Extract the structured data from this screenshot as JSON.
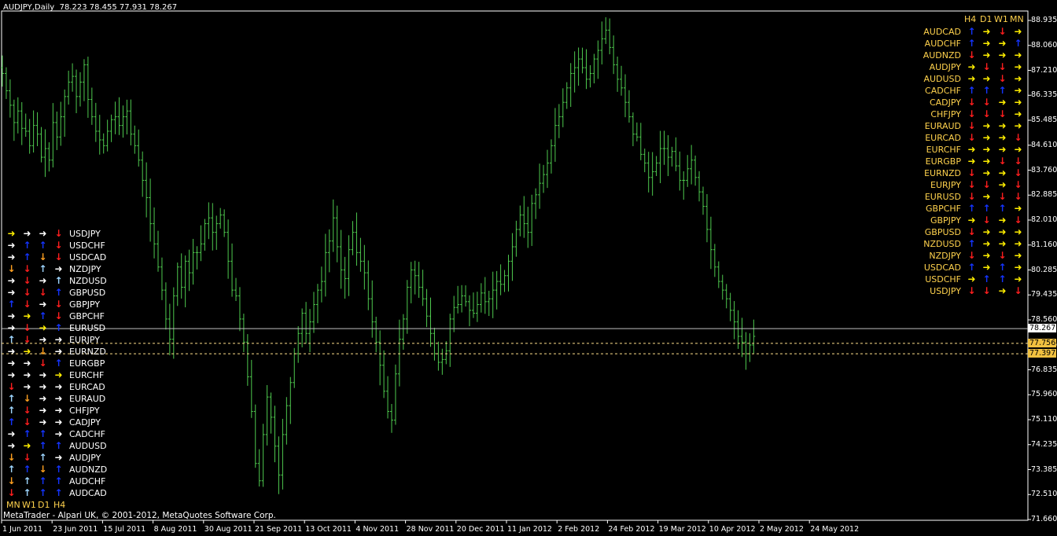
{
  "window": {
    "title": "AUDJPY,Daily",
    "ohlc": "78.223 78.455 77.931 78.267"
  },
  "copyright": "MetaTrader - Alpari UK, © 2001-2012, MetaQuotes Software Corp.",
  "colors": {
    "background": "#000000",
    "candle": "#4ec94e",
    "axis": "#ffffff",
    "arrow_white": "#ffffff",
    "arrow_yellow": "#ffee00",
    "arrow_red": "#ff1e1e",
    "arrow_blue": "#1434ff",
    "arrow_lightblue": "#9ed6ff",
    "arrow_orange": "#ffa020",
    "pair_text_right": "#ffd24d",
    "pair_text_left": "#ffffff",
    "current_price_line": "#c0c0c0",
    "level_line": "#ffe08a"
  },
  "price_axis": {
    "labels": [
      "88.935",
      "88.060",
      "87.210",
      "86.335",
      "85.485",
      "84.610",
      "83.760",
      "82.885",
      "82.010",
      "81.160",
      "80.285",
      "79.435",
      "78.560",
      "77.685",
      "76.835",
      "75.960",
      "75.110",
      "74.235",
      "73.385",
      "72.510",
      "71.660"
    ]
  },
  "date_axis": {
    "labels": [
      "1 Jun 2011",
      "23 Jun 2011",
      "15 Jul 2011",
      "8 Aug 2011",
      "30 Aug 2011",
      "21 Sep 2011",
      "13 Oct 2011",
      "4 Nov 2011",
      "28 Nov 2011",
      "20 Dec 2011",
      "11 Jan 2012",
      "2 Feb 2012",
      "24 Feb 2012",
      "19 Mar 2012",
      "10 Apr 2012",
      "2 May 2012",
      "24 May 2012"
    ]
  },
  "price_markers": {
    "current": "78.267",
    "level1": "77.756",
    "level2": "77.397"
  },
  "chart_data": {
    "type": "bar",
    "ylim": [
      71.66,
      88.935
    ],
    "categories": [
      "1 Jun 2011",
      "23 Jun 2011",
      "15 Jul 2011",
      "8 Aug 2011",
      "30 Aug 2011",
      "21 Sep 2011",
      "13 Oct 2011",
      "4 Nov 2011",
      "28 Nov 2011",
      "20 Dec 2011",
      "11 Jan 2012",
      "2 Feb 2012",
      "24 Feb 2012",
      "19 Mar 2012",
      "10 Apr 2012",
      "2 May 2012",
      "24 May 2012"
    ],
    "close_path": [
      87.1,
      86.5,
      86.0,
      85.4,
      85.8,
      85.2,
      85.1,
      84.6,
      85.3,
      85.0,
      84.2,
      84.5,
      84.1,
      85.4,
      84.9,
      85.6,
      86.3,
      86.8,
      87.0,
      86.3,
      86.8,
      87.4,
      86.2,
      85.6,
      85.1,
      84.8,
      84.6,
      85.1,
      85.5,
      85.6,
      85.3,
      85.6,
      85.8,
      85.0,
      84.6,
      84.1,
      83.4,
      82.8,
      81.9,
      81.2,
      80.4,
      79.6,
      78.6,
      77.9,
      79.4,
      80.4,
      79.7,
      80.6,
      80.2,
      80.9,
      80.9,
      81.2,
      81.9,
      82.1,
      81.6,
      81.9,
      82.2,
      81.6,
      80.6,
      79.6,
      79.4,
      78.6,
      77.8,
      76.6,
      75.4,
      73.6,
      73.0,
      74.6,
      75.9,
      75.2,
      74.2,
      73.2,
      74.6,
      75.6,
      76.4,
      77.4,
      78.1,
      78.8,
      78.1,
      78.5,
      79.1,
      79.6,
      79.9,
      80.9,
      81.3,
      82.1,
      81.1,
      80.3,
      80.0,
      81.0,
      81.6,
      80.9,
      80.6,
      80.2,
      79.3,
      78.5,
      77.8,
      77.0,
      76.1,
      75.4,
      75.1,
      76.7,
      77.9,
      78.6,
      79.7,
      80.3,
      80.1,
      79.7,
      79.3,
      78.7,
      78.1,
      77.4,
      77.1,
      77.2,
      77.5,
      78.6,
      79.0,
      79.1,
      79.4,
      79.2,
      78.9,
      78.8,
      79.1,
      79.5,
      79.2,
      79.3,
      79.6,
      79.9,
      79.8,
      80.1,
      80.6,
      81.1,
      81.7,
      82.2,
      81.9,
      81.6,
      82.6,
      82.9,
      83.3,
      83.6,
      84.0,
      84.6,
      85.3,
      85.6,
      86.1,
      86.6,
      87.1,
      87.3,
      87.6,
      87.3,
      86.9,
      87.1,
      87.6,
      87.9,
      88.3,
      88.6,
      88.0,
      87.4,
      86.9,
      86.6,
      86.1,
      85.6,
      85.0,
      84.9,
      84.3,
      84.0,
      83.5,
      83.7,
      84.0,
      84.5,
      84.5,
      84.2,
      84.4,
      83.9,
      83.4,
      83.4,
      83.8,
      84.1,
      83.5,
      83.0,
      82.5,
      81.7,
      81.0,
      80.4,
      79.9,
      79.6,
      79.3,
      78.9,
      78.5,
      78.0,
      77.8,
      77.4,
      77.7,
      78.0
    ]
  },
  "right_panel": {
    "headers": [
      "H4",
      "D1",
      "W1",
      "MN"
    ],
    "rows": [
      {
        "pair": "AUDCAD",
        "arrows": [
          [
            "up",
            "blue"
          ],
          [
            "right",
            "yellow"
          ],
          [
            "down",
            "red"
          ],
          [
            "right",
            "yellow"
          ]
        ]
      },
      {
        "pair": "AUDCHF",
        "arrows": [
          [
            "up",
            "blue"
          ],
          [
            "right",
            "yellow"
          ],
          [
            "right",
            "yellow"
          ],
          [
            "up",
            "blue"
          ]
        ]
      },
      {
        "pair": "AUDNZD",
        "arrows": [
          [
            "down",
            "red"
          ],
          [
            "right",
            "yellow"
          ],
          [
            "right",
            "yellow"
          ],
          [
            "right",
            "yellow"
          ]
        ]
      },
      {
        "pair": "AUDJPY",
        "arrows": [
          [
            "right",
            "yellow"
          ],
          [
            "down",
            "red"
          ],
          [
            "down",
            "red"
          ],
          [
            "right",
            "yellow"
          ]
        ]
      },
      {
        "pair": "AUDUSD",
        "arrows": [
          [
            "right",
            "yellow"
          ],
          [
            "right",
            "yellow"
          ],
          [
            "down",
            "red"
          ],
          [
            "right",
            "yellow"
          ]
        ]
      },
      {
        "pair": "CADCHF",
        "arrows": [
          [
            "up",
            "blue"
          ],
          [
            "up",
            "blue"
          ],
          [
            "up",
            "blue"
          ],
          [
            "right",
            "yellow"
          ]
        ]
      },
      {
        "pair": "CADJPY",
        "arrows": [
          [
            "down",
            "red"
          ],
          [
            "down",
            "red"
          ],
          [
            "right",
            "yellow"
          ],
          [
            "right",
            "yellow"
          ]
        ]
      },
      {
        "pair": "CHFJPY",
        "arrows": [
          [
            "down",
            "red"
          ],
          [
            "down",
            "red"
          ],
          [
            "down",
            "red"
          ],
          [
            "right",
            "yellow"
          ]
        ]
      },
      {
        "pair": "EURAUD",
        "arrows": [
          [
            "down",
            "red"
          ],
          [
            "right",
            "yellow"
          ],
          [
            "right",
            "yellow"
          ],
          [
            "right",
            "yellow"
          ]
        ]
      },
      {
        "pair": "EURCAD",
        "arrows": [
          [
            "down",
            "red"
          ],
          [
            "right",
            "yellow"
          ],
          [
            "right",
            "yellow"
          ],
          [
            "down",
            "red"
          ]
        ]
      },
      {
        "pair": "EURCHF",
        "arrows": [
          [
            "right",
            "yellow"
          ],
          [
            "right",
            "yellow"
          ],
          [
            "right",
            "yellow"
          ],
          [
            "right",
            "yellow"
          ]
        ]
      },
      {
        "pair": "EURGBP",
        "arrows": [
          [
            "right",
            "yellow"
          ],
          [
            "right",
            "yellow"
          ],
          [
            "down",
            "red"
          ],
          [
            "down",
            "red"
          ]
        ]
      },
      {
        "pair": "EURNZD",
        "arrows": [
          [
            "down",
            "red"
          ],
          [
            "right",
            "yellow"
          ],
          [
            "right",
            "yellow"
          ],
          [
            "down",
            "red"
          ]
        ]
      },
      {
        "pair": "EURJPY",
        "arrows": [
          [
            "down",
            "red"
          ],
          [
            "down",
            "red"
          ],
          [
            "right",
            "yellow"
          ],
          [
            "down",
            "red"
          ]
        ]
      },
      {
        "pair": "EURUSD",
        "arrows": [
          [
            "down",
            "red"
          ],
          [
            "right",
            "yellow"
          ],
          [
            "down",
            "red"
          ],
          [
            "down",
            "red"
          ]
        ]
      },
      {
        "pair": "GBPCHF",
        "arrows": [
          [
            "up",
            "blue"
          ],
          [
            "up",
            "blue"
          ],
          [
            "up",
            "blue"
          ],
          [
            "right",
            "yellow"
          ]
        ]
      },
      {
        "pair": "GBPJPY",
        "arrows": [
          [
            "right",
            "yellow"
          ],
          [
            "down",
            "red"
          ],
          [
            "right",
            "yellow"
          ],
          [
            "down",
            "red"
          ]
        ]
      },
      {
        "pair": "GBPUSD",
        "arrows": [
          [
            "down",
            "red"
          ],
          [
            "right",
            "yellow"
          ],
          [
            "right",
            "yellow"
          ],
          [
            "right",
            "yellow"
          ]
        ]
      },
      {
        "pair": "NZDUSD",
        "arrows": [
          [
            "up",
            "blue"
          ],
          [
            "right",
            "yellow"
          ],
          [
            "right",
            "yellow"
          ],
          [
            "right",
            "yellow"
          ]
        ]
      },
      {
        "pair": "NZDJPY",
        "arrows": [
          [
            "down",
            "red"
          ],
          [
            "right",
            "yellow"
          ],
          [
            "down",
            "red"
          ],
          [
            "right",
            "yellow"
          ]
        ]
      },
      {
        "pair": "USDCAD",
        "arrows": [
          [
            "up",
            "blue"
          ],
          [
            "right",
            "yellow"
          ],
          [
            "up",
            "blue"
          ],
          [
            "right",
            "yellow"
          ]
        ]
      },
      {
        "pair": "USDCHF",
        "arrows": [
          [
            "right",
            "yellow"
          ],
          [
            "up",
            "blue"
          ],
          [
            "up",
            "blue"
          ],
          [
            "right",
            "yellow"
          ]
        ]
      },
      {
        "pair": "USDJPY",
        "arrows": [
          [
            "down",
            "red"
          ],
          [
            "down",
            "red"
          ],
          [
            "right",
            "yellow"
          ],
          [
            "down",
            "red"
          ]
        ]
      }
    ]
  },
  "left_panel": {
    "headers": [
      "MN",
      "W1",
      "D1",
      "H4"
    ],
    "rows": [
      {
        "pair": "USDJPY",
        "arrows": [
          [
            "right",
            "yellow"
          ],
          [
            "right",
            "white"
          ],
          [
            "right",
            "white"
          ],
          [
            "down",
            "red"
          ]
        ]
      },
      {
        "pair": "USDCHF",
        "arrows": [
          [
            "right",
            "white"
          ],
          [
            "up",
            "blue"
          ],
          [
            "up",
            "blue"
          ],
          [
            "down",
            "red"
          ]
        ]
      },
      {
        "pair": "USDCAD",
        "arrows": [
          [
            "right",
            "white"
          ],
          [
            "up",
            "blue"
          ],
          [
            "down",
            "orange"
          ],
          [
            "down",
            "red"
          ]
        ]
      },
      {
        "pair": "NZDJPY",
        "arrows": [
          [
            "down",
            "orange"
          ],
          [
            "down",
            "red"
          ],
          [
            "up",
            "lightblue"
          ],
          [
            "right",
            "white"
          ]
        ]
      },
      {
        "pair": "NZDUSD",
        "arrows": [
          [
            "right",
            "white"
          ],
          [
            "down",
            "red"
          ],
          [
            "right",
            "white"
          ],
          [
            "up",
            "lightblue"
          ]
        ]
      },
      {
        "pair": "GBPUSD",
        "arrows": [
          [
            "right",
            "white"
          ],
          [
            "down",
            "red"
          ],
          [
            "down",
            "red"
          ],
          [
            "up",
            "blue"
          ]
        ]
      },
      {
        "pair": "GBPJPY",
        "arrows": [
          [
            "up",
            "blue"
          ],
          [
            "down",
            "red"
          ],
          [
            "right",
            "white"
          ],
          [
            "down",
            "red"
          ]
        ]
      },
      {
        "pair": "GBPCHF",
        "arrows": [
          [
            "right",
            "white"
          ],
          [
            "right",
            "yellow"
          ],
          [
            "up",
            "blue"
          ],
          [
            "down",
            "red"
          ]
        ]
      },
      {
        "pair": "EURUSD",
        "arrows": [
          [
            "right",
            "white"
          ],
          [
            "down",
            "red"
          ],
          [
            "right",
            "yellow"
          ],
          [
            "up",
            "blue"
          ]
        ]
      },
      {
        "pair": "EURJPY",
        "arrows": [
          [
            "up",
            "lightblue"
          ],
          [
            "down",
            "red"
          ],
          [
            "right",
            "white"
          ],
          [
            "right",
            "white"
          ]
        ]
      },
      {
        "pair": "EURNZD",
        "arrows": [
          [
            "right",
            "white"
          ],
          [
            "right",
            "yellow"
          ],
          [
            "down",
            "orange"
          ],
          [
            "right",
            "white"
          ]
        ]
      },
      {
        "pair": "EURGBP",
        "arrows": [
          [
            "right",
            "white"
          ],
          [
            "right",
            "white"
          ],
          [
            "down",
            "red"
          ],
          [
            "up",
            "blue"
          ]
        ]
      },
      {
        "pair": "EURCHF",
        "arrows": [
          [
            "right",
            "white"
          ],
          [
            "right",
            "white"
          ],
          [
            "right",
            "white"
          ],
          [
            "right",
            "yellow"
          ]
        ]
      },
      {
        "pair": "EURCAD",
        "arrows": [
          [
            "down",
            "red"
          ],
          [
            "right",
            "white"
          ],
          [
            "right",
            "white"
          ],
          [
            "right",
            "white"
          ]
        ]
      },
      {
        "pair": "EURAUD",
        "arrows": [
          [
            "up",
            "lightblue"
          ],
          [
            "down",
            "orange"
          ],
          [
            "right",
            "white"
          ],
          [
            "right",
            "white"
          ]
        ]
      },
      {
        "pair": "CHFJPY",
        "arrows": [
          [
            "up",
            "lightblue"
          ],
          [
            "down",
            "red"
          ],
          [
            "right",
            "white"
          ],
          [
            "right",
            "white"
          ]
        ]
      },
      {
        "pair": "CADJPY",
        "arrows": [
          [
            "up",
            "blue"
          ],
          [
            "down",
            "red"
          ],
          [
            "right",
            "white"
          ],
          [
            "right",
            "white"
          ]
        ]
      },
      {
        "pair": "CADCHF",
        "arrows": [
          [
            "right",
            "white"
          ],
          [
            "up",
            "blue"
          ],
          [
            "up",
            "blue"
          ],
          [
            "right",
            "white"
          ]
        ]
      },
      {
        "pair": "AUDUSD",
        "arrows": [
          [
            "right",
            "white"
          ],
          [
            "right",
            "yellow"
          ],
          [
            "up",
            "blue"
          ],
          [
            "up",
            "blue"
          ]
        ]
      },
      {
        "pair": "AUDJPY",
        "arrows": [
          [
            "down",
            "orange"
          ],
          [
            "down",
            "red"
          ],
          [
            "up",
            "lightblue"
          ],
          [
            "right",
            "white"
          ]
        ]
      },
      {
        "pair": "AUDNZD",
        "arrows": [
          [
            "up",
            "lightblue"
          ],
          [
            "up",
            "blue"
          ],
          [
            "down",
            "orange"
          ],
          [
            "up",
            "blue"
          ]
        ]
      },
      {
        "pair": "AUDCHF",
        "arrows": [
          [
            "down",
            "orange"
          ],
          [
            "up",
            "lightblue"
          ],
          [
            "up",
            "blue"
          ],
          [
            "up",
            "blue"
          ]
        ]
      },
      {
        "pair": "AUDCAD",
        "arrows": [
          [
            "down",
            "red"
          ],
          [
            "up",
            "lightblue"
          ],
          [
            "up",
            "blue"
          ],
          [
            "up",
            "blue"
          ]
        ]
      }
    ]
  }
}
